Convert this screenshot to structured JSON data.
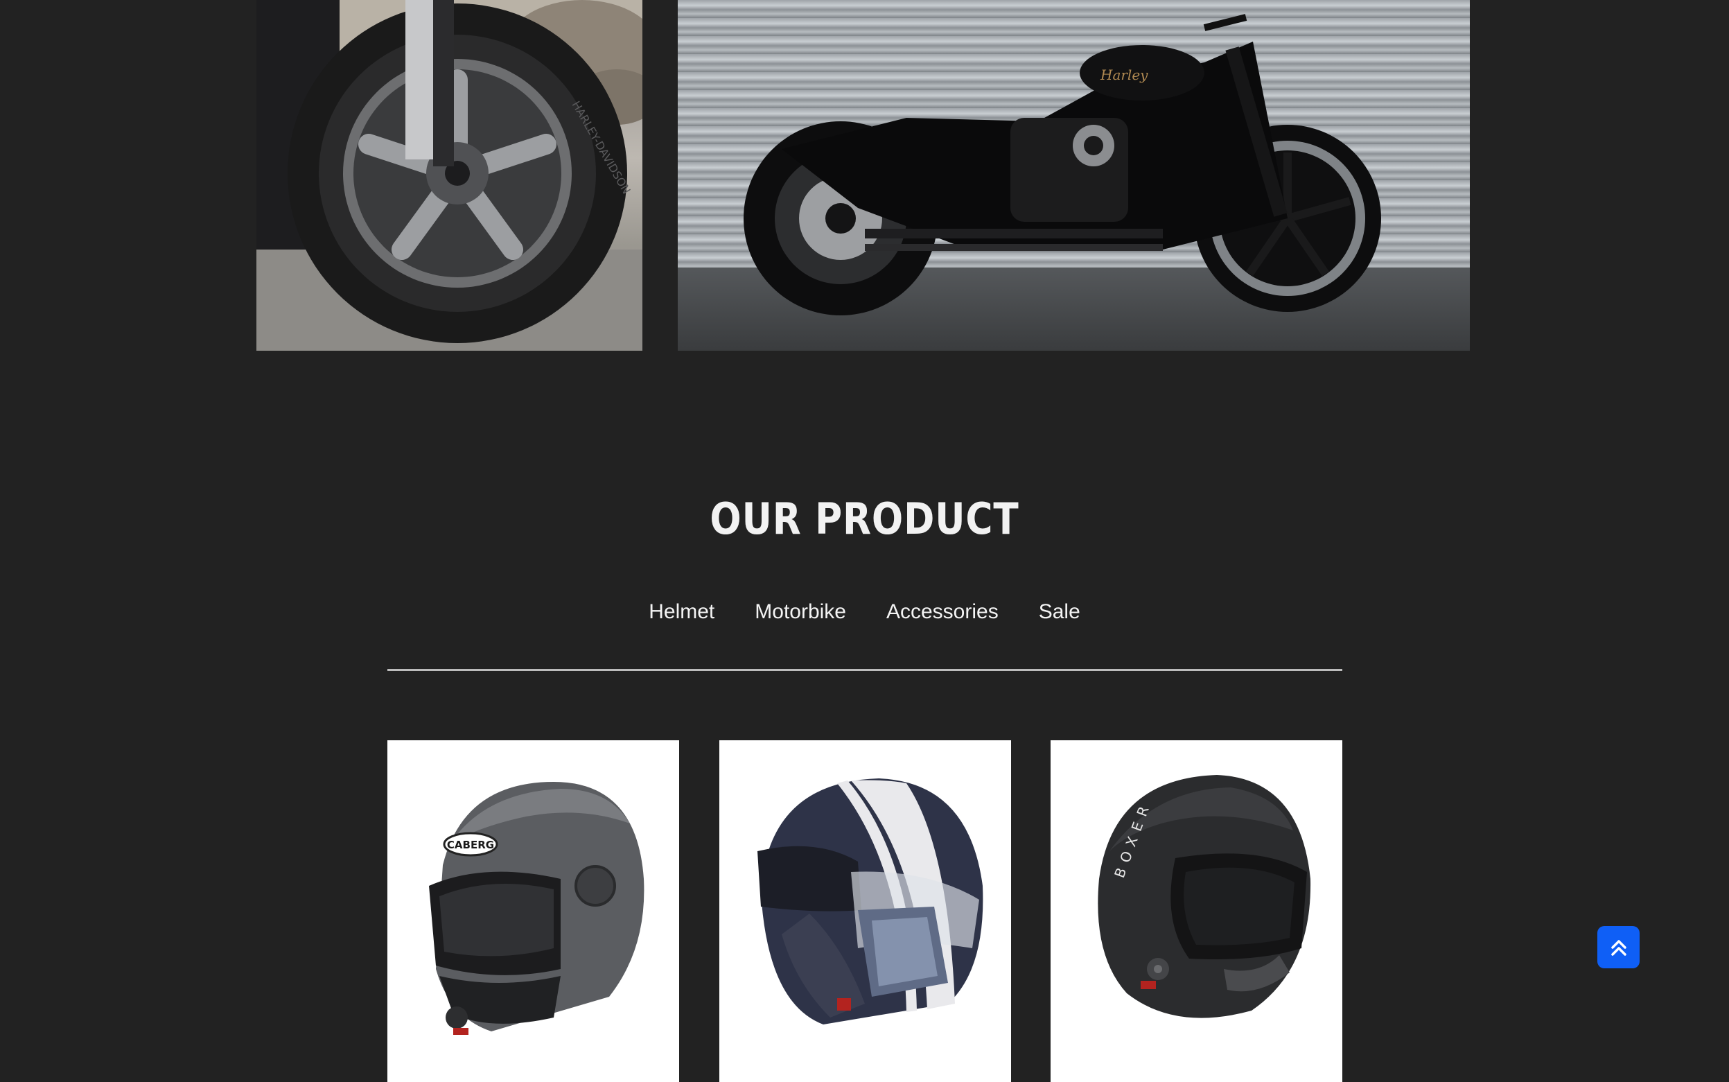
{
  "section": {
    "title": "OUR PRODUCT"
  },
  "tabs": [
    {
      "label": "Helmet"
    },
    {
      "label": "Motorbike"
    },
    {
      "label": "Accessories"
    },
    {
      "label": "Sale"
    }
  ],
  "hero": {
    "tire_brand_text": "HARLEY-DAVIDSON"
  },
  "products": [
    {
      "name": "modular-helmet",
      "logo_text": "CABERG"
    },
    {
      "name": "jet-helmet-with-mask"
    },
    {
      "name": "boxer-helmet",
      "logo_text": "BOXER"
    }
  ],
  "colors": {
    "background": "#222222",
    "text": "#f2f2f2",
    "divider": "#bdbdbd",
    "accent": "#0f5ff6"
  },
  "icons": {
    "back_to_top": "double-chevron-up-icon"
  }
}
